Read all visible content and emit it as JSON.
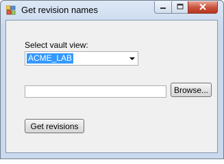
{
  "window": {
    "title": "Get revision names",
    "icons": {
      "app": "app-icon",
      "minimize": "minimize-icon",
      "maximize": "maximize-icon",
      "close": "close-icon"
    }
  },
  "form": {
    "vault_label": "Select vault view:",
    "vault_selected": "ACME_LAB",
    "path_value": "",
    "browse_label": "Browse...",
    "get_revisions_label": "Get revisions"
  }
}
